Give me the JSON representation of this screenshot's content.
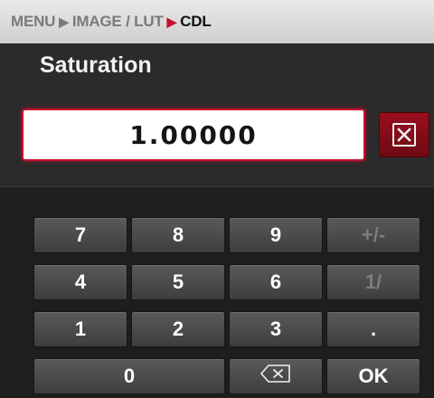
{
  "breadcrumb": {
    "items": [
      "MENU",
      "IMAGE / LUT"
    ],
    "current": "CDL",
    "separator": ">"
  },
  "title": "Saturation",
  "value": "1.00000",
  "clear_icon": "close-box-icon",
  "keypad": {
    "row1": [
      "7",
      "8",
      "9",
      "+/-"
    ],
    "row2": [
      "4",
      "5",
      "6",
      "1/"
    ],
    "row3": [
      "1",
      "2",
      "3",
      "."
    ],
    "zero": "0",
    "backspace_icon": "backspace-icon",
    "ok": "OK",
    "disabled_keys": [
      "+/-",
      "1/"
    ]
  },
  "colors": {
    "accent": "#c8102e",
    "background": "#2b2b2b",
    "key": "#4a4a4a"
  }
}
